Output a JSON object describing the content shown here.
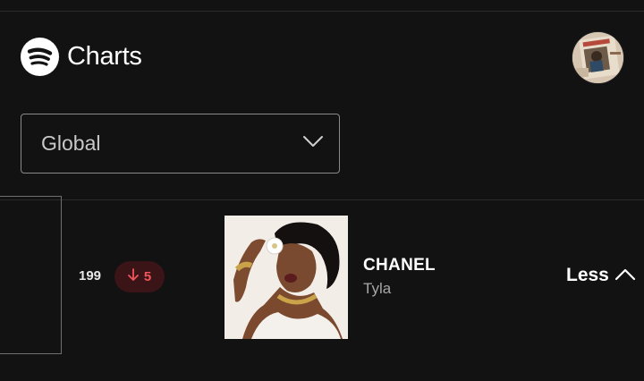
{
  "header": {
    "title": "Charts",
    "logo_icon": "spotify-logo-icon",
    "avatar_icon": "user-avatar-icon"
  },
  "region": {
    "selected": "Global",
    "icon": "chevron-down-icon"
  },
  "entry": {
    "rank": "199",
    "change": "5",
    "change_direction": "down",
    "change_color": "#f0555a",
    "title": "CHANEL",
    "artist": "Tyla",
    "toggle_label": "Less",
    "toggle_icon": "chevron-up-icon"
  }
}
